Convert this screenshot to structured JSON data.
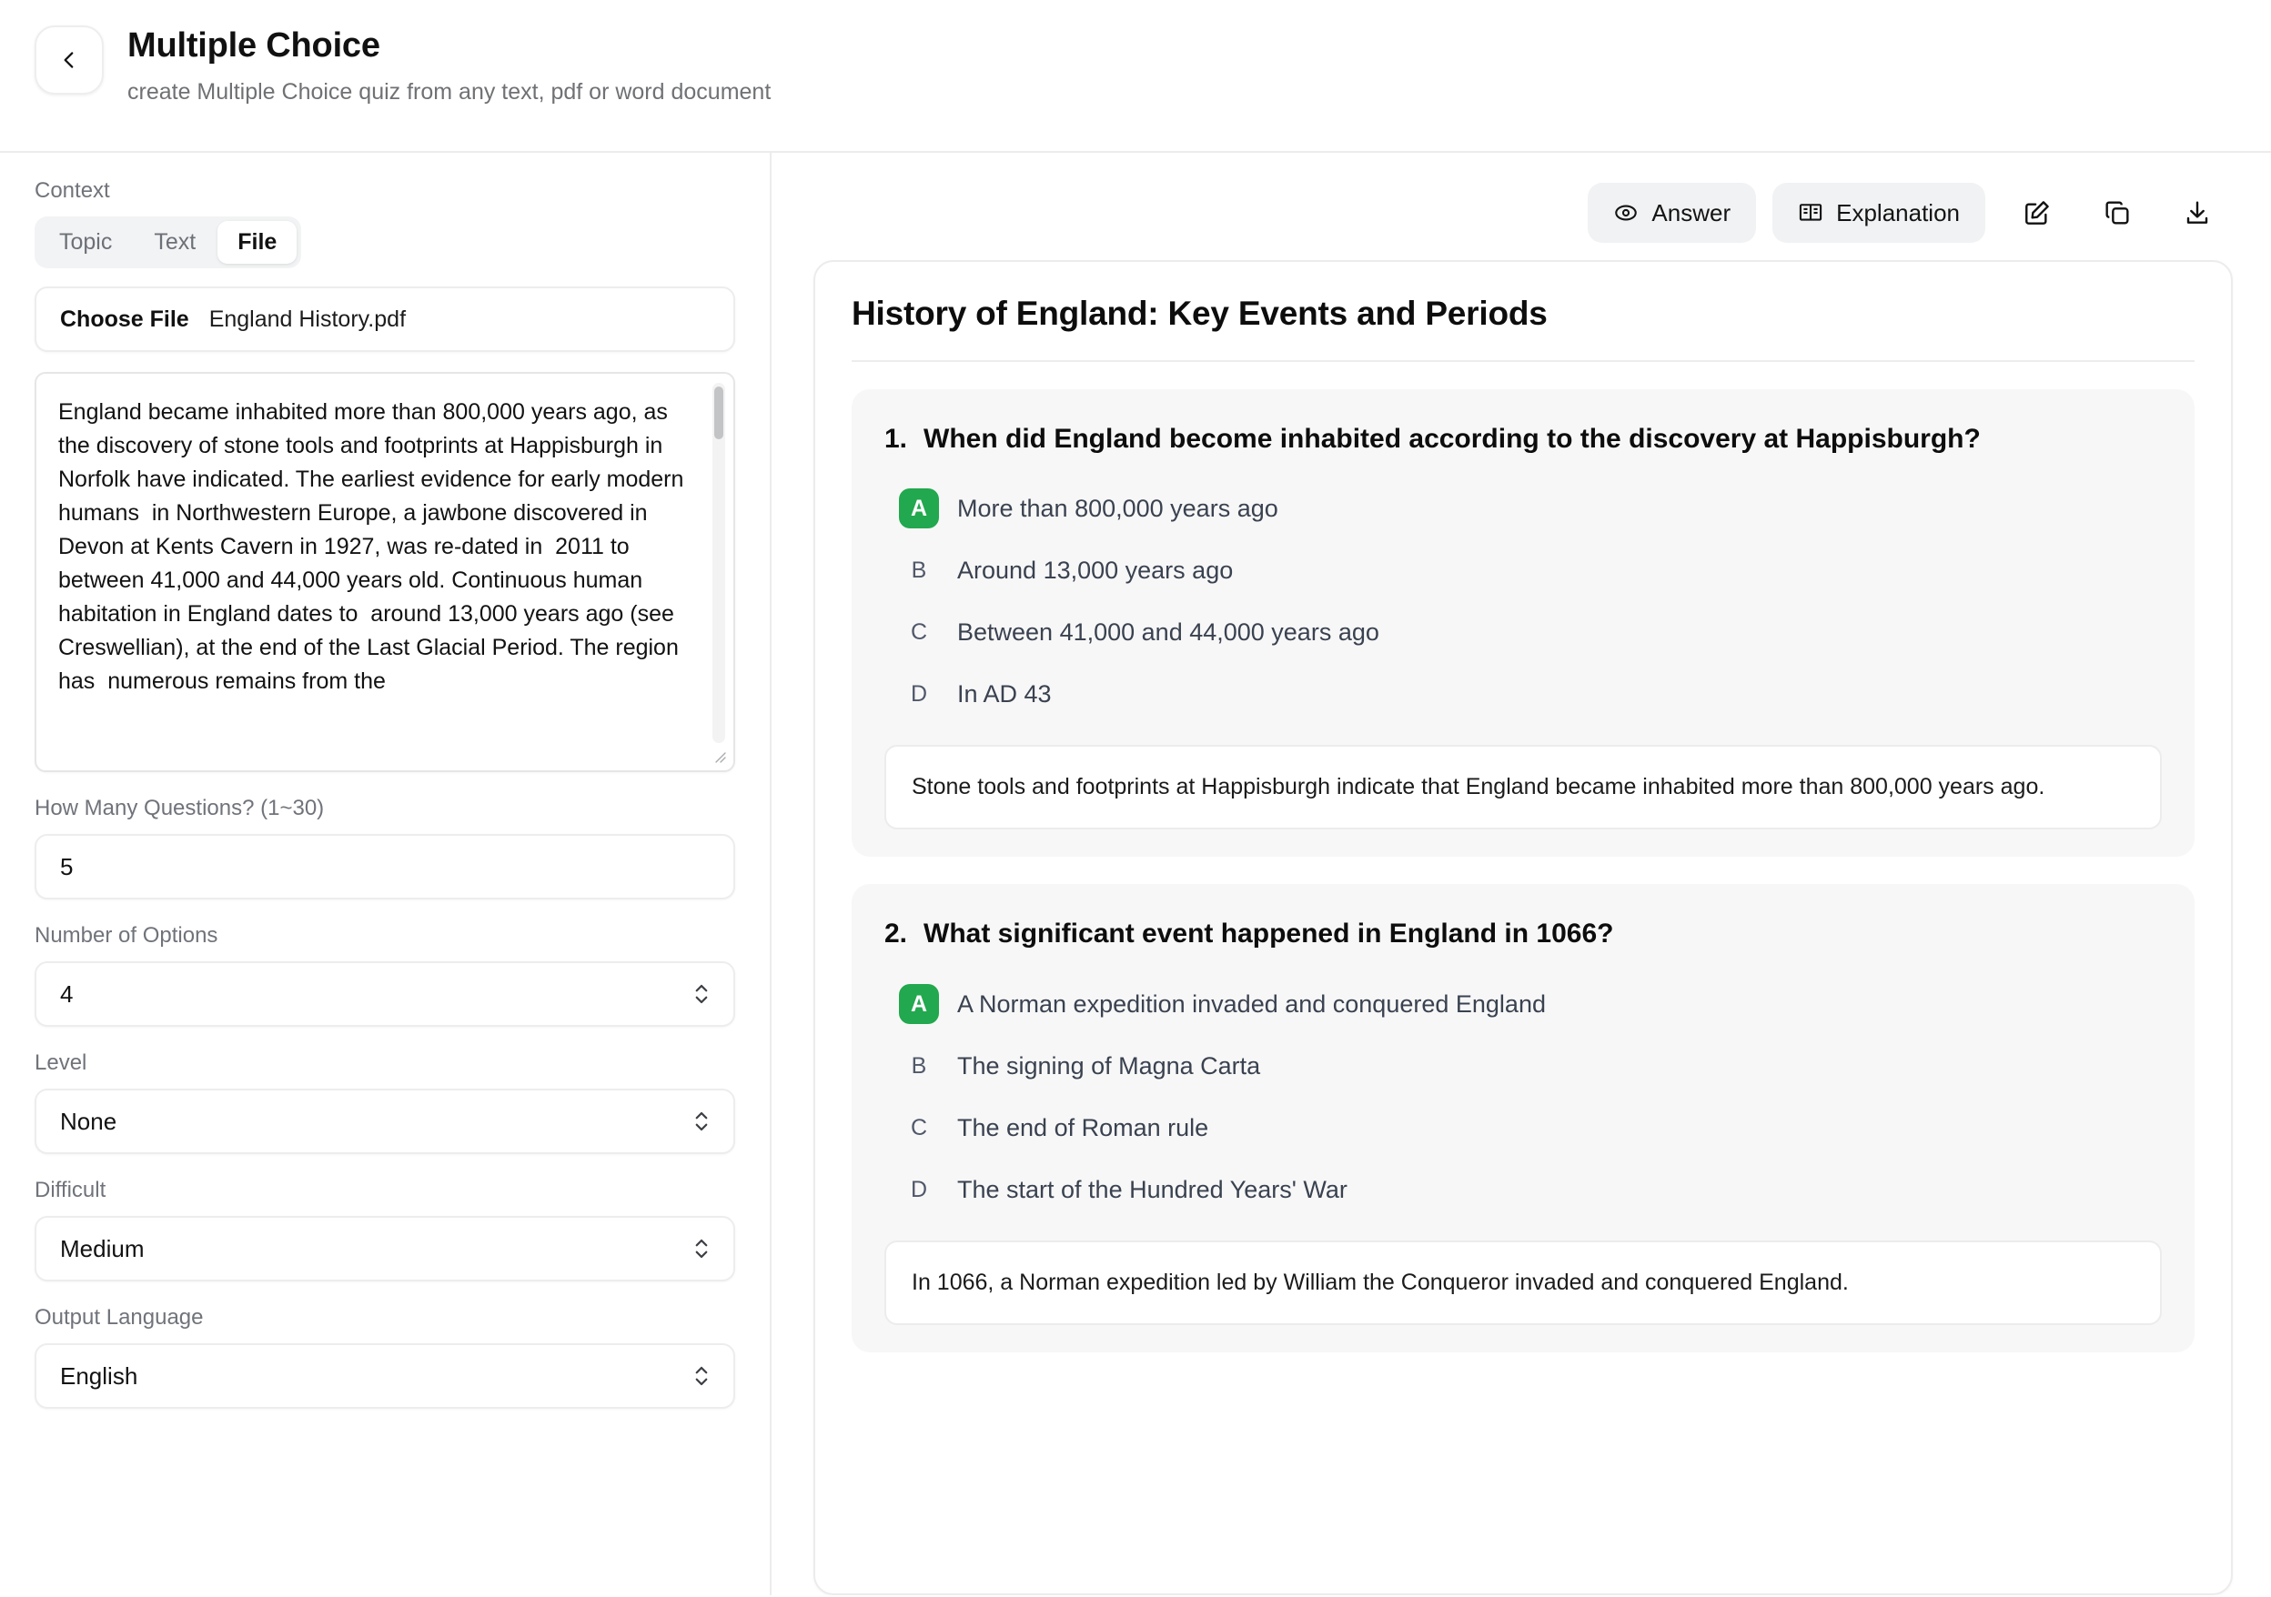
{
  "header": {
    "back_icon": "chevron-left-icon",
    "title": "Multiple Choice",
    "subtitle": "create Multiple Choice quiz from any text, pdf or word document"
  },
  "form": {
    "context_label": "Context",
    "context_tabs": [
      {
        "label": "Topic",
        "active": false
      },
      {
        "label": "Text",
        "active": false
      },
      {
        "label": "File",
        "active": true
      }
    ],
    "file_picker": {
      "button_label": "Choose File",
      "file_name": "England History.pdf"
    },
    "context_text": "England became inhabited more than 800,000 years ago, as the discovery of stone tools and footprints at Happisburgh in Norfolk have indicated. The earliest evidence for early modern humans  in Northwestern Europe, a jawbone discovered in Devon at Kents Cavern in 1927, was re-dated in  2011 to between 41,000 and 44,000 years old. Continuous human habitation in England dates to  around 13,000 years ago (see Creswellian), at the end of the Last Glacial Period. The region has  numerous remains from the",
    "questions_count": {
      "label": "How Many Questions? (1~30)",
      "value": "5"
    },
    "number_of_options": {
      "label": "Number of Options",
      "value": "4"
    },
    "level": {
      "label": "Level",
      "value": "None"
    },
    "difficult": {
      "label": "Difficult",
      "value": "Medium"
    },
    "output_language": {
      "label": "Output Language",
      "value": "English"
    }
  },
  "toolbar": {
    "answer_label": "Answer",
    "answer_icon": "eye-icon",
    "explanation_label": "Explanation",
    "explanation_icon": "book-open-icon",
    "edit_icon": "edit-pencil-square-icon",
    "copy_icon": "copy-icon",
    "download_icon": "download-icon"
  },
  "quiz": {
    "title": "History of England: Key Events and Periods",
    "questions": [
      {
        "number": "1.",
        "text": "When did England become inhabited according to the discovery at Happisburgh?",
        "options": [
          {
            "key": "A",
            "text": "More than 800,000 years ago",
            "correct": true
          },
          {
            "key": "B",
            "text": "Around 13,000 years ago",
            "correct": false
          },
          {
            "key": "C",
            "text": "Between 41,000 and 44,000 years ago",
            "correct": false
          },
          {
            "key": "D",
            "text": "In AD 43",
            "correct": false
          }
        ],
        "explanation": "Stone tools and footprints at Happisburgh indicate that England became inhabited more than 800,000 years ago."
      },
      {
        "number": "2.",
        "text": "What significant event happened in England in 1066?",
        "options": [
          {
            "key": "A",
            "text": "A Norman expedition invaded and conquered England",
            "correct": true
          },
          {
            "key": "B",
            "text": "The signing of Magna Carta",
            "correct": false
          },
          {
            "key": "C",
            "text": "The end of Roman rule",
            "correct": false
          },
          {
            "key": "D",
            "text": "The start of the Hundred Years' War",
            "correct": false
          }
        ],
        "explanation": "In 1066, a Norman expedition led by William the Conqueror invaded and conquered England."
      }
    ]
  },
  "colors": {
    "correct_badge": "#22a84e",
    "card_bg": "#f7f7f7",
    "pill_bg": "#f1f2f3"
  }
}
